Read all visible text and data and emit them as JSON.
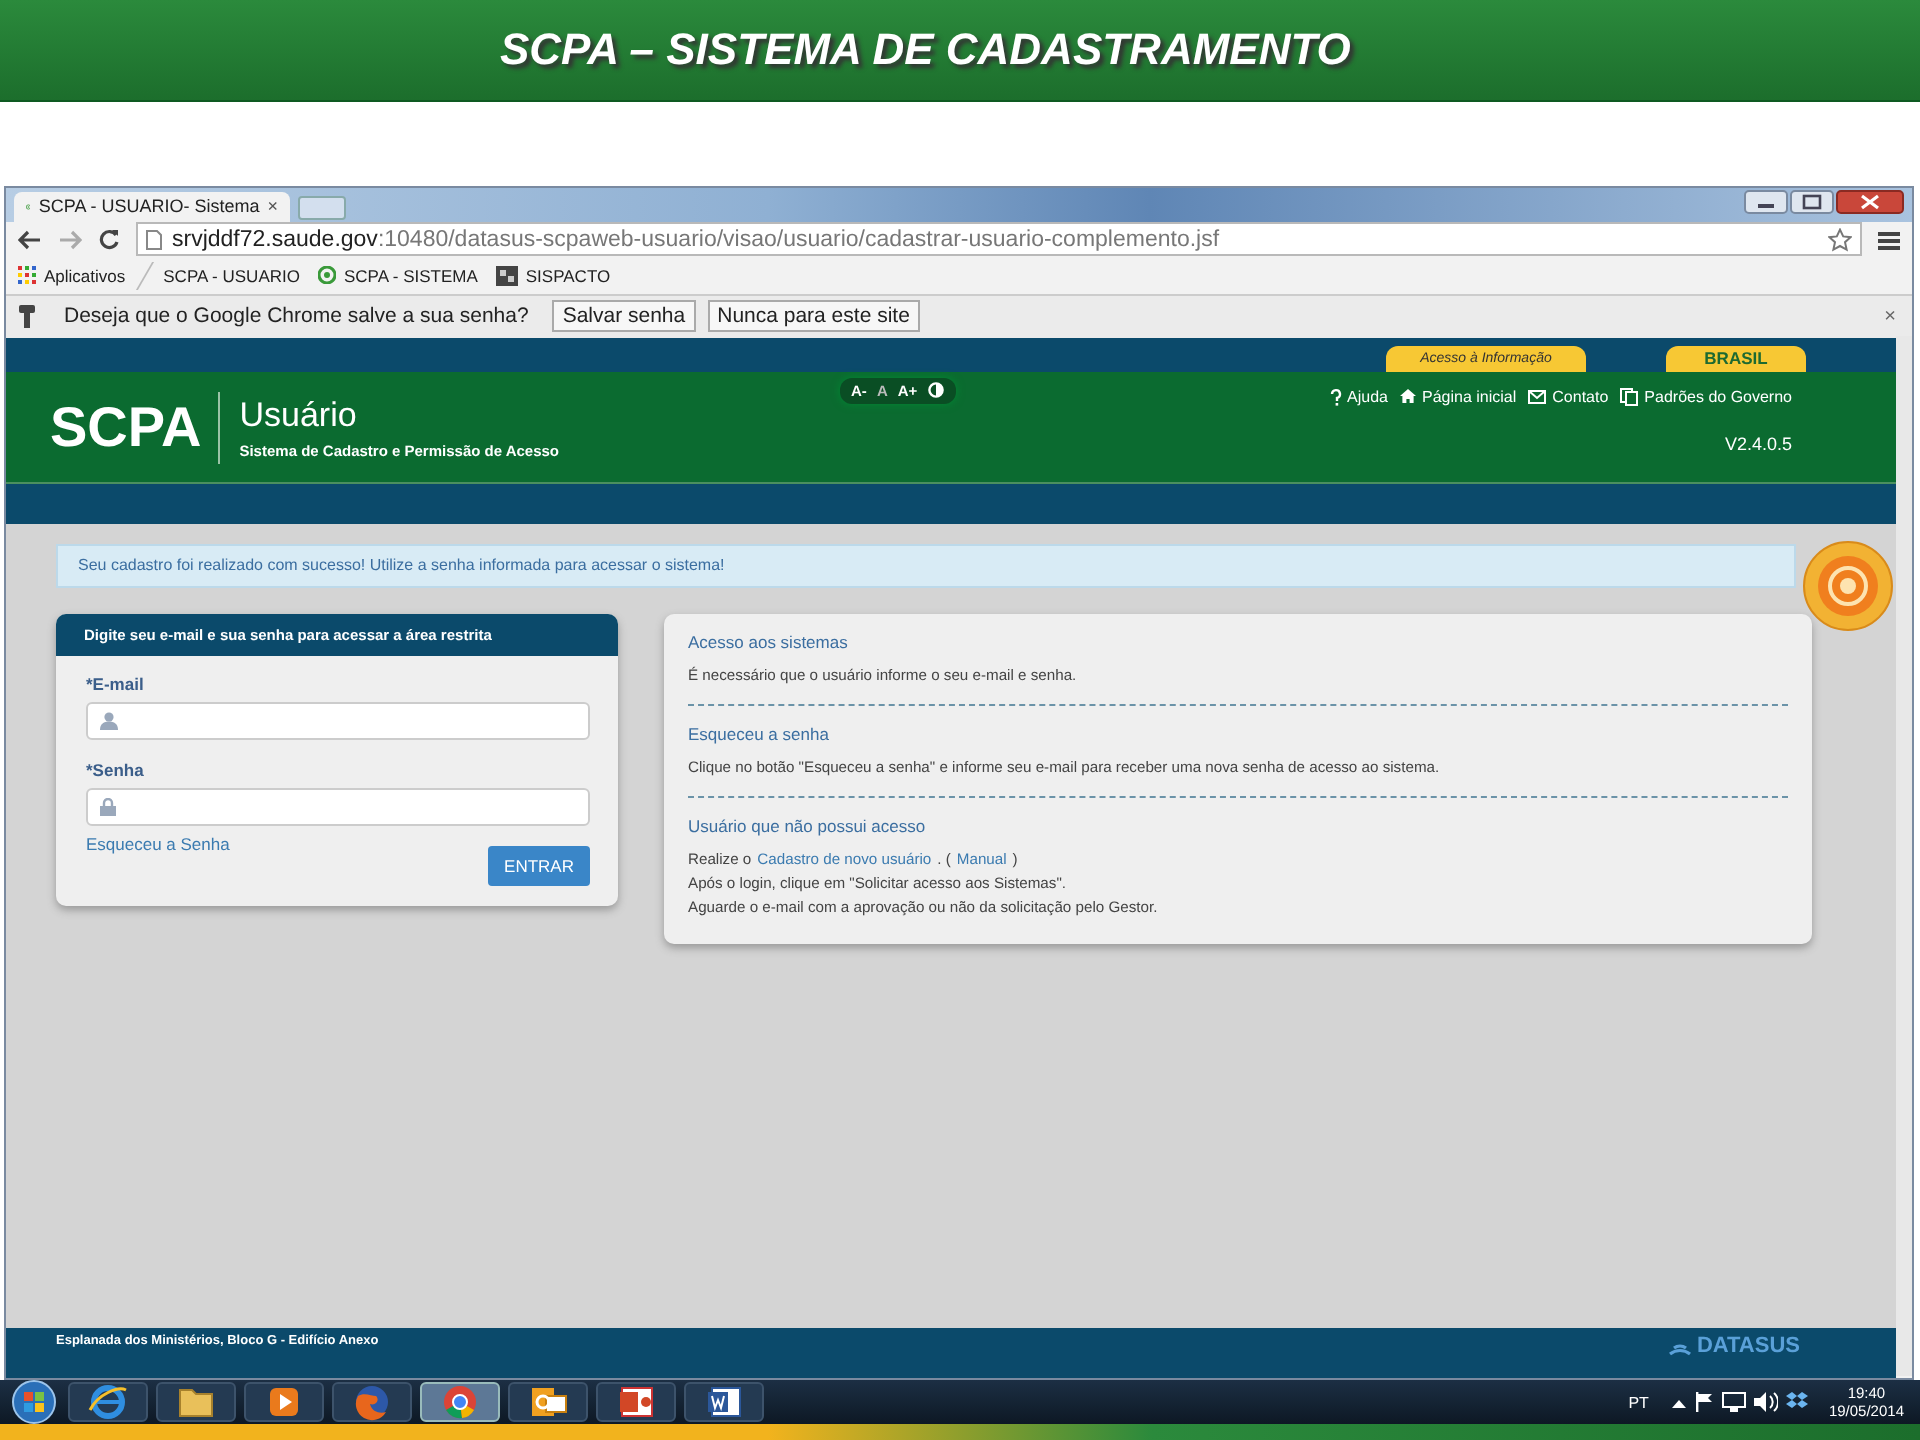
{
  "slide_title": "SCPA – SISTEMA DE CADASTRAMENTO",
  "browser": {
    "tab_title": "SCPA - USUARIO- Sistema",
    "tab_close": "×",
    "address": {
      "host": "srvjddf72.saude.gov",
      "path": ":10480/datasus-scpaweb-usuario/visao/usuario/cadastrar-usuario-complemento.jsf"
    },
    "bookmarks": [
      {
        "label": "Aplicativos",
        "kind": "apps"
      },
      {
        "label": "SCPA - USUARIO",
        "kind": "none"
      },
      {
        "label": "SCPA - SISTEMA",
        "kind": "swirl"
      },
      {
        "label": "SISPACTO",
        "kind": "tile"
      }
    ],
    "password_bar": {
      "message": "Deseja que o Google Chrome salve a sua senha?",
      "buttons": [
        "Salvar senha",
        "Nunca para este site"
      ],
      "close": "×"
    }
  },
  "page": {
    "gov_links": [
      "Acesso à Informação",
      "BRASIL"
    ],
    "header": {
      "logo": "SCPA",
      "title": "Usuário",
      "subtitle": "Sistema de Cadastro e Permissão de Acesso",
      "font_controls": [
        "A-",
        "A",
        "A+"
      ],
      "nav": [
        {
          "label": "Ajuda",
          "kind": "help"
        },
        {
          "label": "Página inicial",
          "kind": "home"
        },
        {
          "label": "Contato",
          "kind": "mail"
        },
        {
          "label": "Padrões do Governo",
          "kind": "pages"
        }
      ],
      "version": "V2.4.0.5"
    },
    "alert": "Seu cadastro foi realizado com sucesso! Utilize a senha informada para acessar o sistema!",
    "login": {
      "heading": "Digite seu e-mail e sua senha para acessar a área restrita",
      "fields": [
        {
          "label": "*E-mail",
          "kind": "user"
        },
        {
          "label": "*Senha",
          "kind": "lock"
        }
      ],
      "forgot": "Esqueceu a Senha",
      "submit": "ENTRAR"
    },
    "info": [
      {
        "title": "Acesso aos sistemas",
        "lines": [
          [
            {
              "text": "É necessário que o usuário informe o seu e-mail e senha.",
              "link": false
            }
          ]
        ]
      },
      {
        "title": "Esqueceu a senha",
        "lines": [
          [
            {
              "text": "Clique no botão \"Esqueceu a senha\" e informe seu e-mail para receber uma nova senha de acesso ao sistema.",
              "link": false
            }
          ]
        ]
      },
      {
        "title": "Usuário que não possui acesso",
        "lines": [
          [
            {
              "text": "Realize o",
              "link": false
            },
            {
              "text": "Cadastro de novo usuário",
              "link": true
            },
            {
              "text": ". (",
              "link": false
            },
            {
              "text": "Manual",
              "link": true
            },
            {
              "text": ")",
              "link": false
            }
          ],
          [
            {
              "text": "Após o login, clique em \"Solicitar acesso aos Sistemas\".",
              "link": false
            }
          ],
          [
            {
              "text": "Aguarde o e-mail com a aprovação ou não da solicitação pelo Gestor.",
              "link": false
            }
          ]
        ]
      }
    ],
    "footer_address": "Esplanada dos Ministérios, Bloco G - Edifício Anexo",
    "footer_brand": "DATASUS"
  },
  "taskbar": {
    "apps": [
      {
        "kind": "ie",
        "selected": false
      },
      {
        "kind": "folder",
        "selected": false
      },
      {
        "kind": "media",
        "selected": false
      },
      {
        "kind": "firefox",
        "selected": false
      },
      {
        "kind": "chrome",
        "selected": true
      },
      {
        "kind": "outlook",
        "selected": false
      },
      {
        "kind": "powerpoint",
        "selected": false
      },
      {
        "kind": "word",
        "selected": false
      }
    ],
    "language": "PT",
    "time": "19:40",
    "date": "19/05/2014"
  }
}
